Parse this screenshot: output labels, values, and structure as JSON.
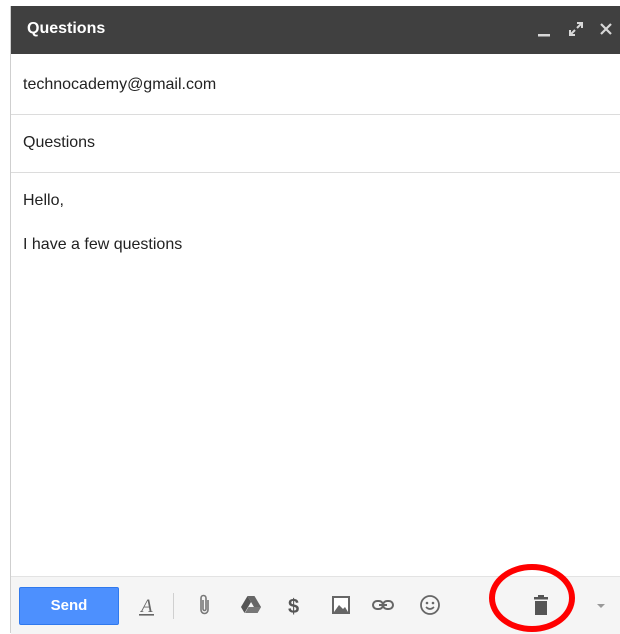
{
  "window": {
    "title": "Questions",
    "controls": [
      "minimize-icon",
      "expand-icon",
      "close-icon"
    ]
  },
  "to_field": {
    "value": "technocademy@gmail.com"
  },
  "subject_field": {
    "value": "Questions"
  },
  "body": {
    "lines": [
      "Hello,",
      "I have a few questions"
    ]
  },
  "toolbar": {
    "send_label": "Send",
    "icons": [
      "format-text-icon",
      "attach-icon",
      "drive-icon",
      "money-icon",
      "photo-icon",
      "link-icon",
      "emoji-icon",
      "trash-icon",
      "more-options-icon"
    ]
  },
  "colors": {
    "titlebar": "#404040",
    "send_button": "#4d90fe",
    "highlight": "#ff0000"
  }
}
